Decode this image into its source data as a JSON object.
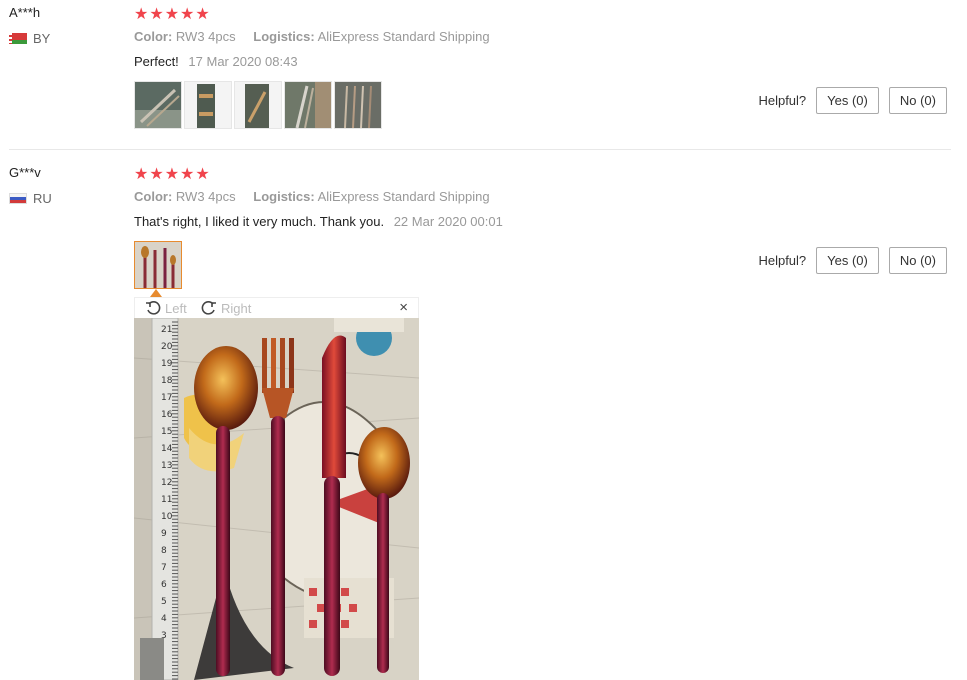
{
  "helpful_label": "Helpful?",
  "reviews": [
    {
      "buyer": "A***h",
      "country": "BY",
      "stars": "★★★★★",
      "color_label": "Color:",
      "color_value": "RW3 4pcs",
      "logistics_label": "Logistics:",
      "logistics_value": "AliExpress Standard Shipping",
      "text": "Perfect!",
      "date": "17 Mar 2020 08:43",
      "yes": "Yes (0)",
      "no": "No (0)"
    },
    {
      "buyer": "G***v",
      "country": "RU",
      "stars": "★★★★★",
      "color_label": "Color:",
      "color_value": "RW3 4pcs",
      "logistics_label": "Logistics:",
      "logistics_value": "AliExpress Standard Shipping",
      "text": "That's right, I liked it very much. Thank you.",
      "date": "22 Mar 2020 00:01",
      "yes": "Yes (0)",
      "no": "No (0)"
    }
  ],
  "viewer": {
    "rotate_left": "Left",
    "rotate_right": "Right",
    "close": "×"
  },
  "ruler_numbers": [
    "21",
    "20",
    "19",
    "18",
    "17",
    "16",
    "15",
    "14",
    "13",
    "12",
    "11",
    "10",
    "9",
    "8",
    "7",
    "6",
    "5",
    "4",
    "3"
  ]
}
